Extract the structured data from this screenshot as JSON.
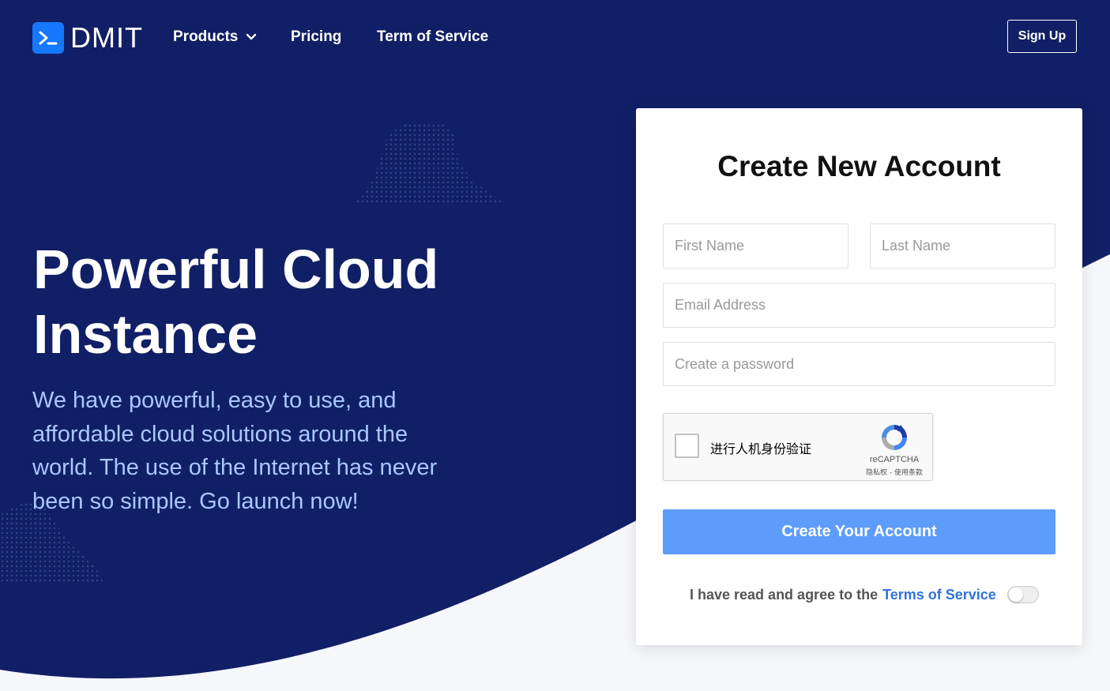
{
  "brand": {
    "name": "DMIT",
    "icon": "terminal-icon",
    "icon_color": "#1677ff"
  },
  "nav": {
    "items": [
      {
        "label": "Products",
        "has_dropdown": true
      },
      {
        "label": "Pricing"
      },
      {
        "label": "Term of Service"
      }
    ],
    "signup_label": "Sign Up"
  },
  "hero": {
    "title_line1": "Powerful Cloud",
    "title_line2": "Instance",
    "subtitle": "We have powerful, easy to use, and affordable cloud solutions around the world. The use of the Internet has never been so simple. Go launch now!"
  },
  "form": {
    "title": "Create New Account",
    "first_name_placeholder": "First Name",
    "last_name_placeholder": "Last Name",
    "email_placeholder": "Email Address",
    "password_placeholder": "Create a password",
    "captcha": {
      "label": "进行人机身份验证",
      "brand": "reCAPTCHA",
      "links": "隐私权 - 使用条款"
    },
    "submit_label": "Create Your Account",
    "agree_prefix": "I have read and agree to the",
    "agree_link": "Terms of Service",
    "agree_toggle_on": false
  },
  "colors": {
    "navy": "#111f66",
    "accent_blue": "#5d9cfa",
    "link_blue": "#2f73da",
    "subtitle_blue": "#a9c8ff",
    "background_light": "#f6f7fb"
  }
}
